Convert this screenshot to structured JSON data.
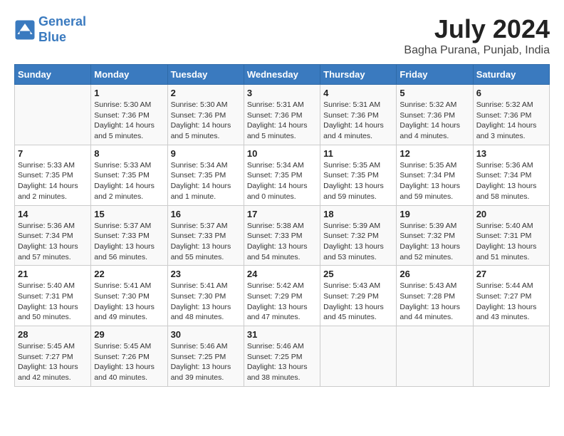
{
  "header": {
    "logo_line1": "General",
    "logo_line2": "Blue",
    "title": "July 2024",
    "subtitle": "Bagha Purana, Punjab, India"
  },
  "columns": [
    "Sunday",
    "Monday",
    "Tuesday",
    "Wednesday",
    "Thursday",
    "Friday",
    "Saturday"
  ],
  "weeks": [
    [
      {
        "day": "",
        "text": ""
      },
      {
        "day": "1",
        "text": "Sunrise: 5:30 AM\nSunset: 7:36 PM\nDaylight: 14 hours\nand 5 minutes."
      },
      {
        "day": "2",
        "text": "Sunrise: 5:30 AM\nSunset: 7:36 PM\nDaylight: 14 hours\nand 5 minutes."
      },
      {
        "day": "3",
        "text": "Sunrise: 5:31 AM\nSunset: 7:36 PM\nDaylight: 14 hours\nand 5 minutes."
      },
      {
        "day": "4",
        "text": "Sunrise: 5:31 AM\nSunset: 7:36 PM\nDaylight: 14 hours\nand 4 minutes."
      },
      {
        "day": "5",
        "text": "Sunrise: 5:32 AM\nSunset: 7:36 PM\nDaylight: 14 hours\nand 4 minutes."
      },
      {
        "day": "6",
        "text": "Sunrise: 5:32 AM\nSunset: 7:36 PM\nDaylight: 14 hours\nand 3 minutes."
      }
    ],
    [
      {
        "day": "7",
        "text": "Sunrise: 5:33 AM\nSunset: 7:35 PM\nDaylight: 14 hours\nand 2 minutes."
      },
      {
        "day": "8",
        "text": "Sunrise: 5:33 AM\nSunset: 7:35 PM\nDaylight: 14 hours\nand 2 minutes."
      },
      {
        "day": "9",
        "text": "Sunrise: 5:34 AM\nSunset: 7:35 PM\nDaylight: 14 hours\nand 1 minute."
      },
      {
        "day": "10",
        "text": "Sunrise: 5:34 AM\nSunset: 7:35 PM\nDaylight: 14 hours\nand 0 minutes."
      },
      {
        "day": "11",
        "text": "Sunrise: 5:35 AM\nSunset: 7:35 PM\nDaylight: 13 hours\nand 59 minutes."
      },
      {
        "day": "12",
        "text": "Sunrise: 5:35 AM\nSunset: 7:34 PM\nDaylight: 13 hours\nand 59 minutes."
      },
      {
        "day": "13",
        "text": "Sunrise: 5:36 AM\nSunset: 7:34 PM\nDaylight: 13 hours\nand 58 minutes."
      }
    ],
    [
      {
        "day": "14",
        "text": "Sunrise: 5:36 AM\nSunset: 7:34 PM\nDaylight: 13 hours\nand 57 minutes."
      },
      {
        "day": "15",
        "text": "Sunrise: 5:37 AM\nSunset: 7:33 PM\nDaylight: 13 hours\nand 56 minutes."
      },
      {
        "day": "16",
        "text": "Sunrise: 5:37 AM\nSunset: 7:33 PM\nDaylight: 13 hours\nand 55 minutes."
      },
      {
        "day": "17",
        "text": "Sunrise: 5:38 AM\nSunset: 7:33 PM\nDaylight: 13 hours\nand 54 minutes."
      },
      {
        "day": "18",
        "text": "Sunrise: 5:39 AM\nSunset: 7:32 PM\nDaylight: 13 hours\nand 53 minutes."
      },
      {
        "day": "19",
        "text": "Sunrise: 5:39 AM\nSunset: 7:32 PM\nDaylight: 13 hours\nand 52 minutes."
      },
      {
        "day": "20",
        "text": "Sunrise: 5:40 AM\nSunset: 7:31 PM\nDaylight: 13 hours\nand 51 minutes."
      }
    ],
    [
      {
        "day": "21",
        "text": "Sunrise: 5:40 AM\nSunset: 7:31 PM\nDaylight: 13 hours\nand 50 minutes."
      },
      {
        "day": "22",
        "text": "Sunrise: 5:41 AM\nSunset: 7:30 PM\nDaylight: 13 hours\nand 49 minutes."
      },
      {
        "day": "23",
        "text": "Sunrise: 5:41 AM\nSunset: 7:30 PM\nDaylight: 13 hours\nand 48 minutes."
      },
      {
        "day": "24",
        "text": "Sunrise: 5:42 AM\nSunset: 7:29 PM\nDaylight: 13 hours\nand 47 minutes."
      },
      {
        "day": "25",
        "text": "Sunrise: 5:43 AM\nSunset: 7:29 PM\nDaylight: 13 hours\nand 45 minutes."
      },
      {
        "day": "26",
        "text": "Sunrise: 5:43 AM\nSunset: 7:28 PM\nDaylight: 13 hours\nand 44 minutes."
      },
      {
        "day": "27",
        "text": "Sunrise: 5:44 AM\nSunset: 7:27 PM\nDaylight: 13 hours\nand 43 minutes."
      }
    ],
    [
      {
        "day": "28",
        "text": "Sunrise: 5:45 AM\nSunset: 7:27 PM\nDaylight: 13 hours\nand 42 minutes."
      },
      {
        "day": "29",
        "text": "Sunrise: 5:45 AM\nSunset: 7:26 PM\nDaylight: 13 hours\nand 40 minutes."
      },
      {
        "day": "30",
        "text": "Sunrise: 5:46 AM\nSunset: 7:25 PM\nDaylight: 13 hours\nand 39 minutes."
      },
      {
        "day": "31",
        "text": "Sunrise: 5:46 AM\nSunset: 7:25 PM\nDaylight: 13 hours\nand 38 minutes."
      },
      {
        "day": "",
        "text": ""
      },
      {
        "day": "",
        "text": ""
      },
      {
        "day": "",
        "text": ""
      }
    ]
  ]
}
